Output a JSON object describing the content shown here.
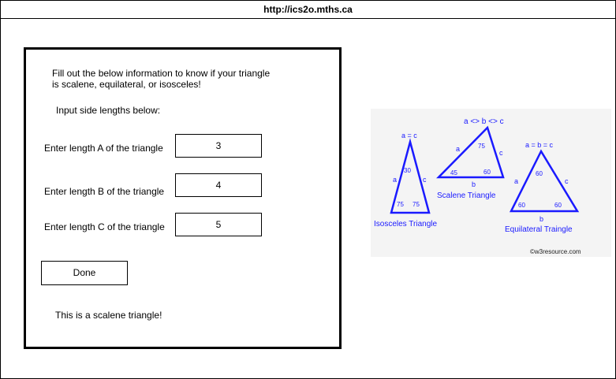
{
  "browser": {
    "url": "http://ics2o.mths.ca"
  },
  "form": {
    "intro": "Fill out the below information to know if your triangle is scalene, equilateral, or isosceles!",
    "subheading": "Input side lengths below:",
    "fields": [
      {
        "label": "Enter length A of the triangle",
        "value": "3"
      },
      {
        "label": "Enter length B of the triangle",
        "value": "4"
      },
      {
        "label": "Enter length C of the triangle",
        "value": "5"
      }
    ],
    "done_label": "Done",
    "result": "This is a scalene triangle!"
  },
  "figure": {
    "accent_color": "#1a1aff",
    "isosceles": {
      "title": "Isosceles Triangle",
      "top_label": "a = c",
      "side_a": "a",
      "side_c": "c",
      "angle_top": "30",
      "angle_left": "75",
      "angle_right": "75",
      "degree": "0"
    },
    "scalene": {
      "title": "Scalene Triangle",
      "top_label": "a <> b <> c",
      "side_a": "a",
      "side_b": "b",
      "side_c": "c",
      "angle_top": "75",
      "angle_left": "45",
      "angle_right": "60",
      "degree": "0"
    },
    "equilateral": {
      "title": "Equilateral Traingle",
      "top_label": "a = b = c",
      "side_a": "a",
      "side_b": "b",
      "side_c": "c",
      "angle_top": "60",
      "angle_left": "60",
      "angle_right": "60",
      "degree": "0"
    },
    "credit": "©w3resource.com"
  }
}
